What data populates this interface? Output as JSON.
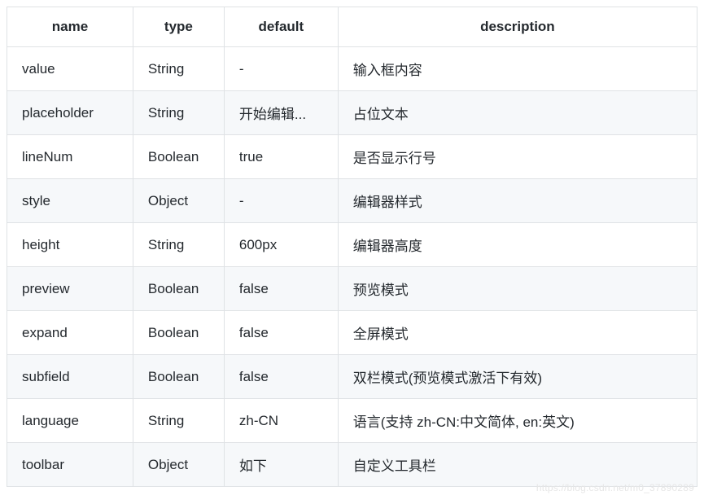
{
  "table": {
    "headers": {
      "name": "name",
      "type": "type",
      "default": "default",
      "description": "description"
    },
    "rows": [
      {
        "name": "value",
        "type": "String",
        "default": "-",
        "description": "输入框内容"
      },
      {
        "name": "placeholder",
        "type": "String",
        "default": "开始编辑...",
        "description": "占位文本"
      },
      {
        "name": "lineNum",
        "type": "Boolean",
        "default": "true",
        "description": "是否显示行号"
      },
      {
        "name": "style",
        "type": "Object",
        "default": "-",
        "description": "编辑器样式"
      },
      {
        "name": "height",
        "type": "String",
        "default": "600px",
        "description": "编辑器高度"
      },
      {
        "name": "preview",
        "type": "Boolean",
        "default": "false",
        "description": "预览模式"
      },
      {
        "name": "expand",
        "type": "Boolean",
        "default": "false",
        "description": "全屏模式"
      },
      {
        "name": "subfield",
        "type": "Boolean",
        "default": "false",
        "description": "双栏模式(预览模式激活下有效)"
      },
      {
        "name": "language",
        "type": "String",
        "default": "zh-CN",
        "description": "语言(支持 zh-CN:中文简体, en:英文)"
      },
      {
        "name": "toolbar",
        "type": "Object",
        "default": "如下",
        "description": "自定义工具栏"
      }
    ]
  },
  "watermark": "https://blog.csdn.net/m0_37890289"
}
